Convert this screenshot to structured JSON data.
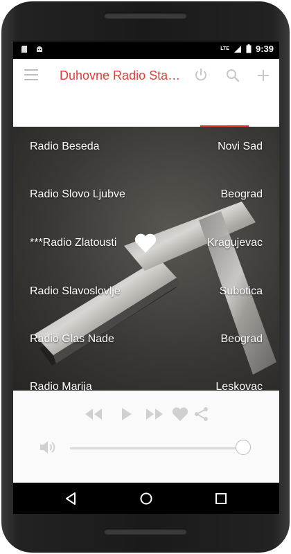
{
  "status_bar": {
    "time": "9:39",
    "network": "LTE",
    "icons": [
      "sd-card-icon",
      "android-icon",
      "signal-icon",
      "battery-icon"
    ]
  },
  "toolbar": {
    "title": "Duhovne Radio Sta…",
    "icons": [
      "menu-icon",
      "power-icon",
      "search-icon",
      "add-icon"
    ],
    "accent_color": "#e53935"
  },
  "stations": [
    {
      "name": "Radio Beseda",
      "city": "Novi Sad",
      "favorite": false
    },
    {
      "name": "Radio Slovo Ljubve",
      "city": "Beograd",
      "favorite": false
    },
    {
      "name": "***Radio Zlatousti",
      "city": "Kragujevac",
      "favorite": true
    },
    {
      "name": "Radio Slavoslovlje",
      "city": "Subotica",
      "favorite": false
    },
    {
      "name": "Radio Glas Nade",
      "city": "Beograd",
      "favorite": false
    },
    {
      "name": "Radio Marija",
      "city": "Leskovac",
      "favorite": false
    }
  ],
  "player": {
    "controls": [
      "rewind-icon",
      "play-icon",
      "fast-forward-icon",
      "heart-icon",
      "share-icon"
    ],
    "volume_level": 1.0
  },
  "nav_bar": {
    "buttons": [
      "back-icon",
      "home-icon",
      "recents-icon"
    ]
  }
}
